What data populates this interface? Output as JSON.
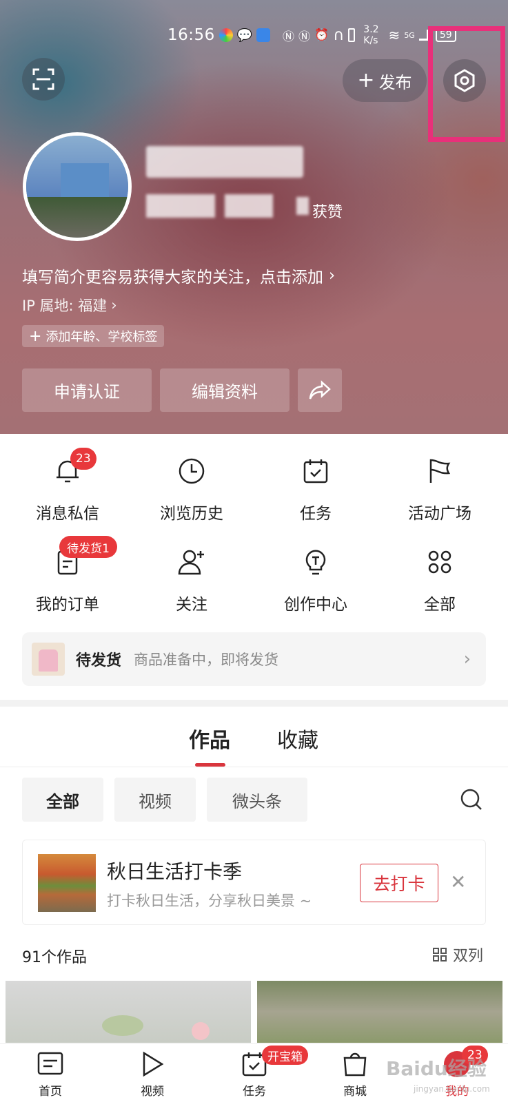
{
  "status_bar": {
    "time": "16:56",
    "speed_top": "3.2",
    "speed_bottom": "K/s",
    "signal": "5G",
    "battery": "59"
  },
  "header": {
    "publish_label": "发布"
  },
  "profile": {
    "likes_label": "获赞",
    "bio": "填写简介更容易获得大家的关注，点击添加",
    "ip": "IP 属地: 福建",
    "add_tags": "添加年龄、学校标签",
    "btn_verify": "申请认证",
    "btn_edit": "编辑资料"
  },
  "grid": {
    "items": [
      {
        "label": "消息私信",
        "badge": "23"
      },
      {
        "label": "浏览历史"
      },
      {
        "label": "任务"
      },
      {
        "label": "活动广场"
      },
      {
        "label": "我的订单",
        "badge": "待发货1"
      },
      {
        "label": "关注"
      },
      {
        "label": "创作中心"
      },
      {
        "label": "全部"
      }
    ]
  },
  "pending": {
    "title": "待发货",
    "subtitle": "商品准备中，即将发货"
  },
  "tabs": {
    "works": "作品",
    "favorites": "收藏"
  },
  "filters": {
    "all": "全部",
    "video": "视频",
    "micro": "微头条"
  },
  "banner": {
    "title": "秋日生活打卡季",
    "subtitle": "打卡秋日生活，分享秋日美景 ~",
    "button": "去打卡"
  },
  "works": {
    "count": "91个作品",
    "layout": "双列"
  },
  "nav": {
    "home": "首页",
    "video": "视频",
    "task": "任务",
    "task_badge": "开宝箱",
    "mall": "商城",
    "me": "我的",
    "me_badge": "23"
  },
  "watermark": {
    "line1": "Baidu经验",
    "line2": "jingyan.baidu.com"
  },
  "colors": {
    "accent": "#d9353d",
    "badge": "#e8383b",
    "highlight": "#e8307a"
  }
}
